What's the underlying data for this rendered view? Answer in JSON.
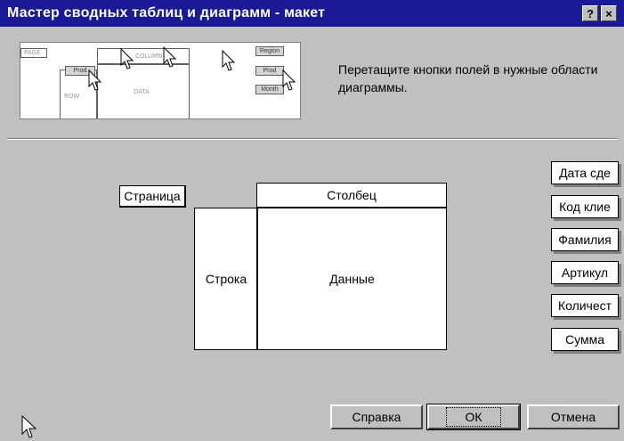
{
  "window": {
    "title": "Мастер сводных таблиц и диаграмм - макет",
    "help_button": "?",
    "close_button": "×"
  },
  "preview": {
    "labels": {
      "page": "PAGE",
      "column": "COLUMN",
      "row": "ROW",
      "data": "DATA",
      "btn1": "Prod",
      "btn2": "Region",
      "btn3": "Prod",
      "btn4": "Month",
      "btn5": "Prod"
    }
  },
  "hint": "Перетащите кнопки полей в нужные области диаграммы.",
  "areas": {
    "page": "Страница",
    "column": "Столбец",
    "row": "Строка",
    "data": "Данные"
  },
  "fields": [
    {
      "label": "Дата сде"
    },
    {
      "label": "Код клие"
    },
    {
      "label": "Фамилия"
    },
    {
      "label": "Артикул"
    },
    {
      "label": "Количест"
    },
    {
      "label": "Сумма"
    }
  ],
  "buttons": {
    "help": "Справка",
    "ok": "ОК",
    "cancel": "Отмена"
  }
}
